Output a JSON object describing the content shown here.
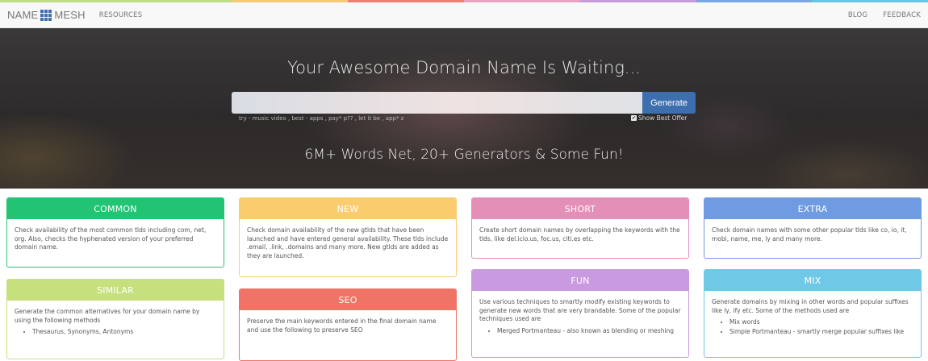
{
  "colors": {
    "rainbow": [
      "#c0dd85",
      "#c0dd85",
      "#f7c97a",
      "#ee7f72",
      "#e6a3c3",
      "#c79bd8",
      "#7aa7e1",
      "#68c6e3"
    ],
    "brand_blue": "#3d6fae",
    "common": "#22c373",
    "new": "#fbcc6e",
    "short": "#e38fb8",
    "extra": "#6e9be2",
    "similar": "#c6e07e",
    "seo": "#ee7465",
    "fun": "#c99ae0",
    "mix": "#6ec8e6"
  },
  "navbar": {
    "brand_left": "NAME",
    "brand_icon": "grid-icon",
    "brand_right": "MESH",
    "resources": "RESOURCES",
    "blog": "BLOG",
    "feedback": "FEEDBACK"
  },
  "hero": {
    "title": "Your Awesome Domain Name Is Waiting...",
    "search_value": "",
    "generate_label": "Generate",
    "hint": "try - music video , best - apps , pay* p?? , let it be , app* z",
    "best_offer_label": "Show Best Offer",
    "subtitle": "6M+ Words Net, 20+ Generators & Some Fun!"
  },
  "cards": {
    "common": {
      "title": "COMMON",
      "body": "Check availability of the most common tlds including com, net, org. Also, checks the hyphenated version of your preferred domain name."
    },
    "new": {
      "title": "NEW",
      "body": "Check domain availability of the new gtlds that have been launched and have entered general availability. These tlds include .email, .link, .domains and many more. New gtlds are added as they are launched."
    },
    "short": {
      "title": "SHORT",
      "body": "Create short domain names by overlapping the keywords with the tlds, like del.icio.us, foc.us, citi.es etc."
    },
    "extra": {
      "title": "EXTRA",
      "body": "Check domain names with some other popular tlds like co, io, it, mobi, name, me, ly and many more."
    },
    "similar": {
      "title": "SIMILAR",
      "body": "Generate the common alternatives for your domain name by using the following methods",
      "items": [
        "Thesaurus, Synonyms, Antonyms"
      ]
    },
    "seo": {
      "title": "SEO",
      "body": "Preserve the main keywords entered in the final domain name and use the following to preserve SEO"
    },
    "fun": {
      "title": "FUN",
      "body": "Use various techniques to smartly modify existing keywords to generate new words that are very brandable. Some of the popular techniques used are",
      "items": [
        "Merged Portmanteau - also known as blending or meshing"
      ]
    },
    "mix": {
      "title": "MIX",
      "body": "Generate domains by mixing in other words and popular suffixes like ly, ify etc. Some of the methods used are",
      "items": [
        "Mix words",
        "Simple Portmanteau - smartly merge popular suffixes like"
      ]
    }
  }
}
